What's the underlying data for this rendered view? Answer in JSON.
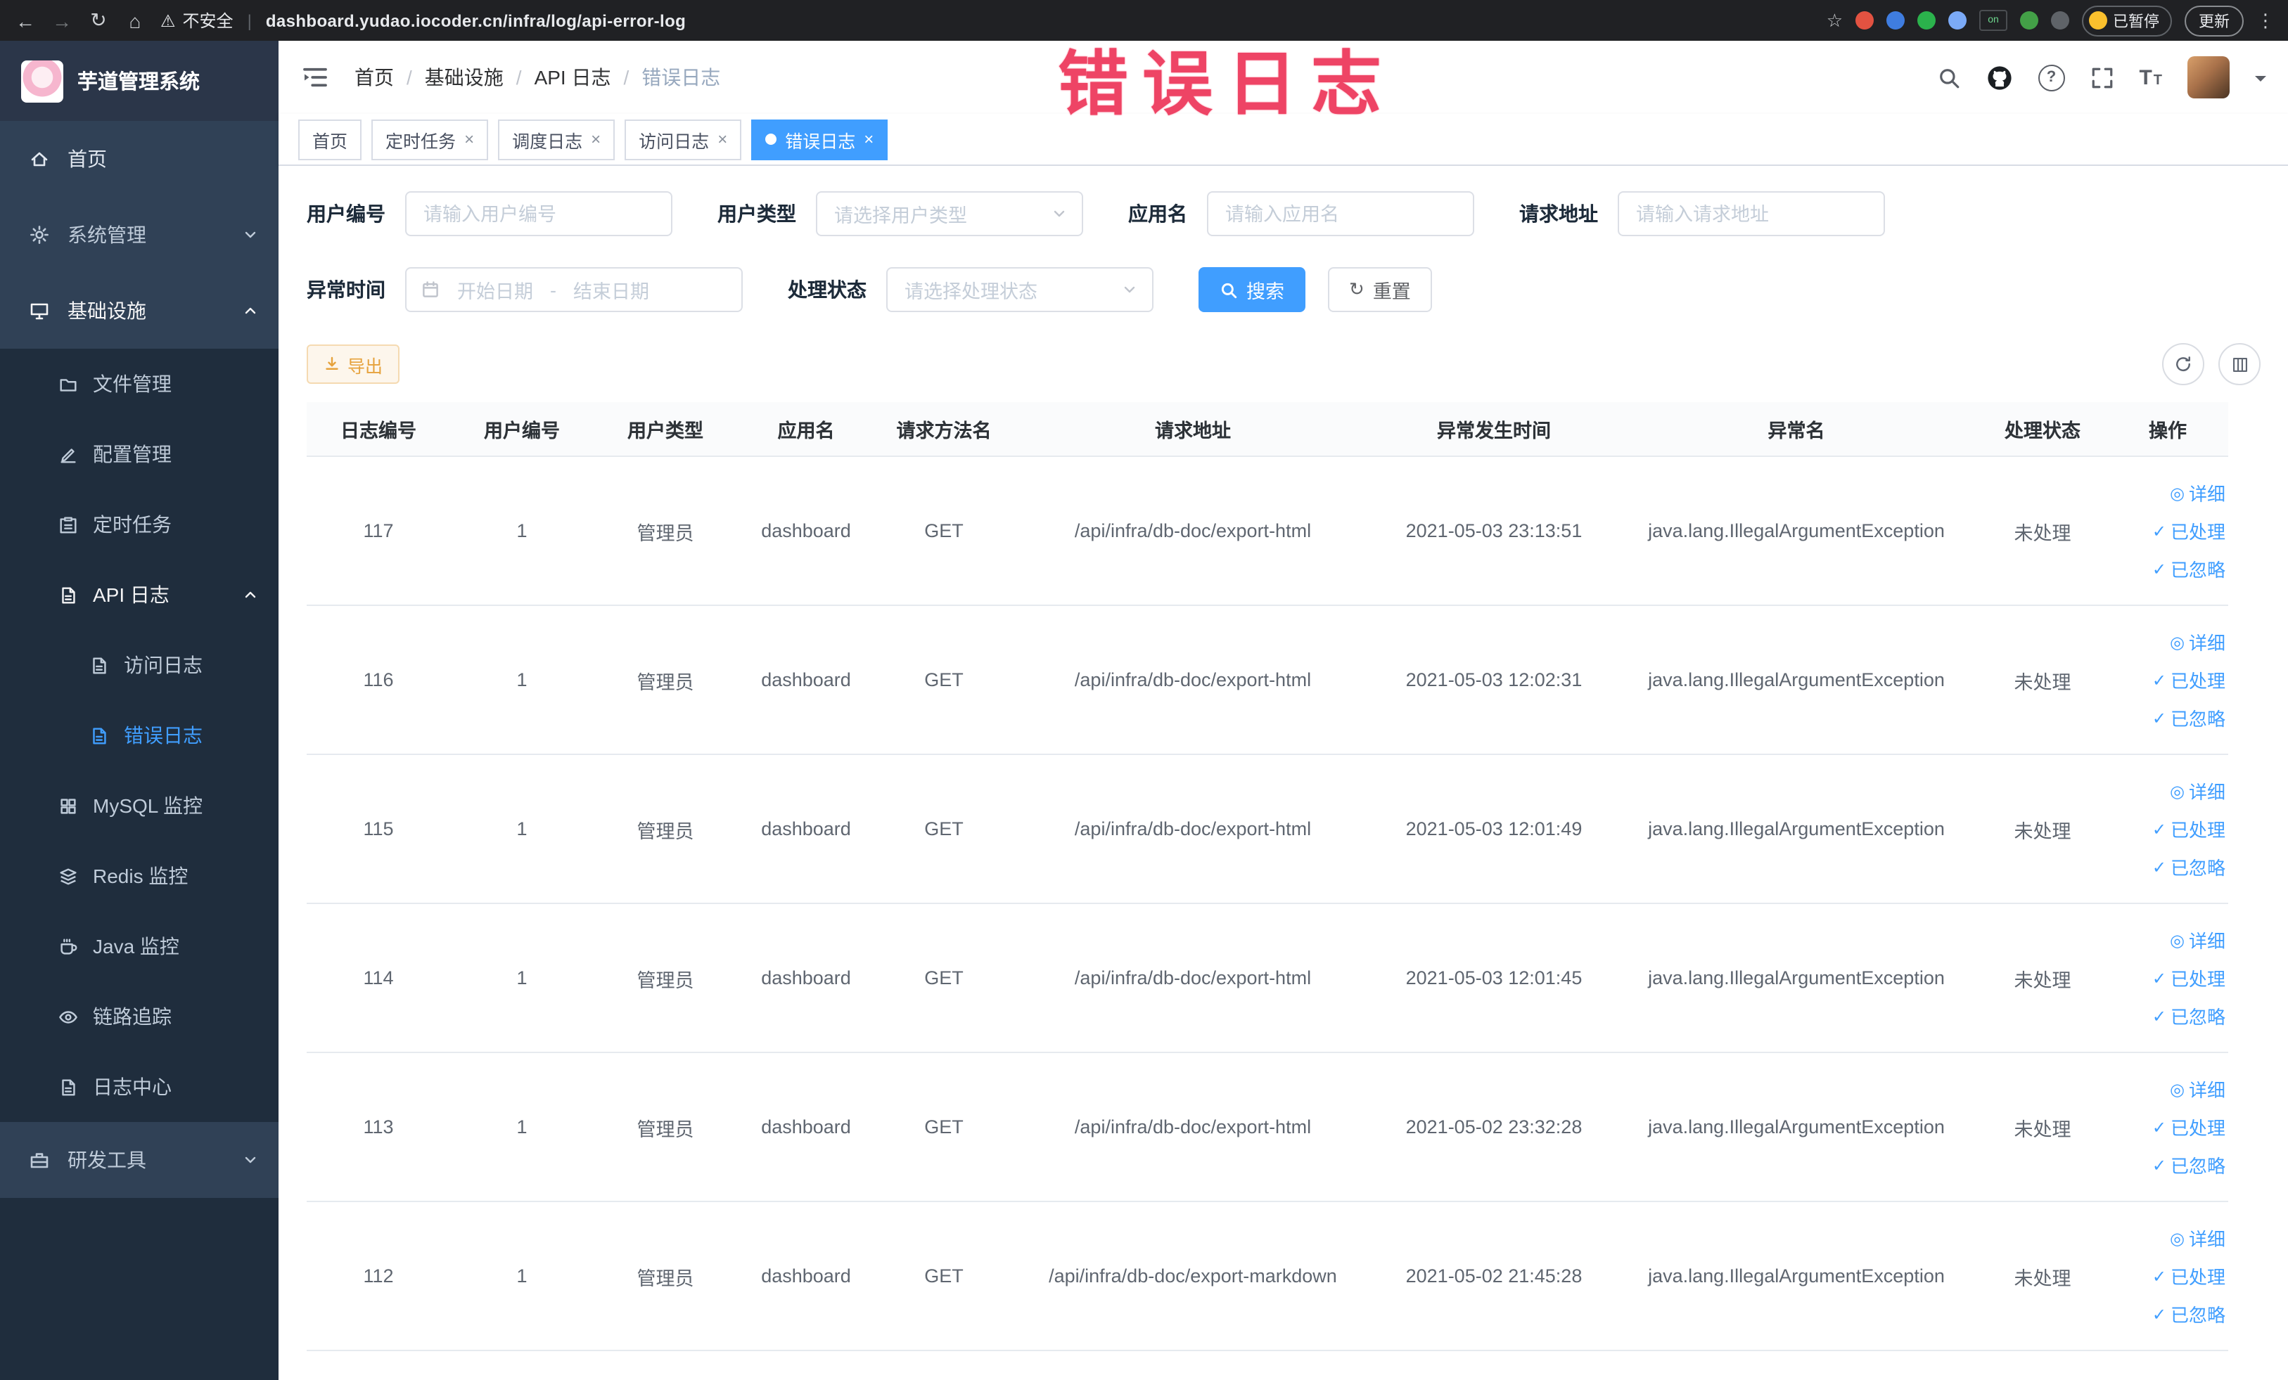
{
  "browser": {
    "security_label": "不安全",
    "url": "dashboard.yudao.iocoder.cn/infra/log/api-error-log",
    "paused_badge": "已暂停",
    "on_badge": "on",
    "update_button": "更新"
  },
  "annotation": {
    "text": "错误日志",
    "color": "#ee4465"
  },
  "sidebar": {
    "logo_title": "芋道管理系统",
    "items": {
      "home": "首页",
      "system": "系统管理",
      "infra": "基础设施",
      "file": "文件管理",
      "config": "配置管理",
      "job": "定时任务",
      "api_log": "API 日志",
      "access_log": "访问日志",
      "error_log": "错误日志",
      "mysql": "MySQL 监控",
      "redis": "Redis 监控",
      "java": "Java 监控",
      "trace": "链路追踪",
      "log_center": "日志中心",
      "dev_tools": "研发工具"
    }
  },
  "header": {
    "breadcrumb": [
      "首页",
      "基础设施",
      "API 日志",
      "错误日志"
    ]
  },
  "tabs": [
    {
      "label": "首页"
    },
    {
      "label": "定时任务"
    },
    {
      "label": "调度日志"
    },
    {
      "label": "访问日志"
    },
    {
      "label": "错误日志"
    }
  ],
  "filters": {
    "user_id": {
      "label": "用户编号",
      "placeholder": "请输入用户编号"
    },
    "user_type": {
      "label": "用户类型",
      "placeholder": "请选择用户类型"
    },
    "app_name": {
      "label": "应用名",
      "placeholder": "请输入应用名"
    },
    "request_url": {
      "label": "请求地址",
      "placeholder": "请输入请求地址"
    },
    "exception_time": {
      "label": "异常时间",
      "start_placeholder": "开始日期",
      "separator": "-",
      "end_placeholder": "结束日期"
    },
    "process_status": {
      "label": "处理状态",
      "placeholder": "请选择处理状态"
    },
    "search_button": "搜索",
    "reset_button": "重置"
  },
  "toolbar": {
    "export_button": "导出"
  },
  "table": {
    "columns": [
      "日志编号",
      "用户编号",
      "用户类型",
      "应用名",
      "请求方法名",
      "请求地址",
      "异常发生时间",
      "异常名",
      "处理状态",
      "操作"
    ],
    "actions": {
      "detail": "详细",
      "processed": "已处理",
      "ignored": "已忽略"
    },
    "rows": [
      {
        "id": "117",
        "user_id": "1",
        "user_type": "管理员",
        "app": "dashboard",
        "method": "GET",
        "url": "/api/infra/db-doc/export-html",
        "time": "2021-05-03 23:13:51",
        "exception": "java.lang.IllegalArgumentException",
        "status": "未处理"
      },
      {
        "id": "116",
        "user_id": "1",
        "user_type": "管理员",
        "app": "dashboard",
        "method": "GET",
        "url": "/api/infra/db-doc/export-html",
        "time": "2021-05-03 12:02:31",
        "exception": "java.lang.IllegalArgumentException",
        "status": "未处理"
      },
      {
        "id": "115",
        "user_id": "1",
        "user_type": "管理员",
        "app": "dashboard",
        "method": "GET",
        "url": "/api/infra/db-doc/export-html",
        "time": "2021-05-03 12:01:49",
        "exception": "java.lang.IllegalArgumentException",
        "status": "未处理"
      },
      {
        "id": "114",
        "user_id": "1",
        "user_type": "管理员",
        "app": "dashboard",
        "method": "GET",
        "url": "/api/infra/db-doc/export-html",
        "time": "2021-05-03 12:01:45",
        "exception": "java.lang.IllegalArgumentException",
        "status": "未处理"
      },
      {
        "id": "113",
        "user_id": "1",
        "user_type": "管理员",
        "app": "dashboard",
        "method": "GET",
        "url": "/api/infra/db-doc/export-html",
        "time": "2021-05-02 23:32:28",
        "exception": "java.lang.IllegalArgumentException",
        "status": "未处理"
      },
      {
        "id": "112",
        "user_id": "1",
        "user_type": "管理员",
        "app": "dashboard",
        "method": "GET",
        "url": "/api/infra/db-doc/export-markdown",
        "time": "2021-05-02 21:45:28",
        "exception": "java.lang.IllegalArgumentException",
        "status": "未处理"
      }
    ]
  }
}
